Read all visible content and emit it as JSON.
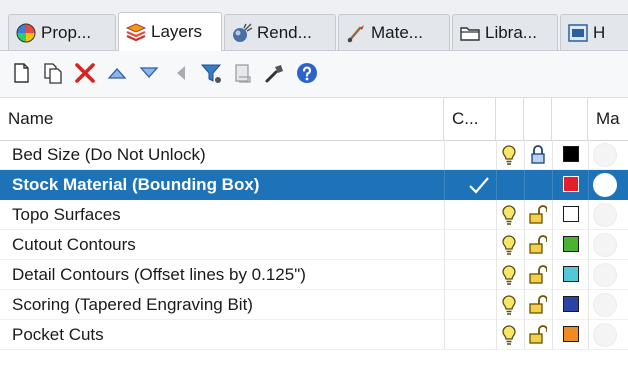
{
  "tabs": [
    {
      "label": "Prop...",
      "icon": "properties-icon",
      "active": false
    },
    {
      "label": "Layers",
      "icon": "layers-icon",
      "active": true
    },
    {
      "label": "Rend...",
      "icon": "render-icon",
      "active": false
    },
    {
      "label": "Mate...",
      "icon": "materials-icon",
      "active": false
    },
    {
      "label": "Libra...",
      "icon": "libraries-icon",
      "active": false
    },
    {
      "label": "H",
      "icon": "help-panel-icon",
      "active": false
    }
  ],
  "toolbar": {
    "items": [
      "new-layer-icon",
      "new-sublayer-icon",
      "delete-icon",
      "move-up-icon",
      "move-down-icon",
      "move-to-parent-icon",
      "filter-icon",
      "layer-tools-icon",
      "settings-icon",
      "help-icon"
    ]
  },
  "columns": {
    "name": "Name",
    "current": "C...",
    "material": "Ma"
  },
  "colors": {
    "selected_row": "#1e73b8",
    "tab_bar": "#eef0f3"
  },
  "layers": [
    {
      "name": "Bed Size (Do Not Unlock)",
      "current": false,
      "visible": true,
      "locked": true,
      "color": "#000000",
      "selected": false
    },
    {
      "name": "Stock Material (Bounding Box)",
      "current": true,
      "visible": false,
      "locked": false,
      "color": "#e3202a",
      "selected": true
    },
    {
      "name": "Topo Surfaces",
      "current": false,
      "visible": true,
      "locked": false,
      "color": "#ffffff",
      "selected": false
    },
    {
      "name": "Cutout Contours",
      "current": false,
      "visible": true,
      "locked": false,
      "color": "#4cb233",
      "selected": false
    },
    {
      "name": "Detail Contours (Offset lines by 0.125\")",
      "current": false,
      "visible": true,
      "locked": false,
      "color": "#54c7d8",
      "selected": false
    },
    {
      "name": "Scoring (Tapered Engraving Bit)",
      "current": false,
      "visible": true,
      "locked": false,
      "color": "#2c43a6",
      "selected": false
    },
    {
      "name": "Pocket Cuts",
      "current": false,
      "visible": true,
      "locked": false,
      "color": "#f08a24",
      "selected": false
    }
  ]
}
